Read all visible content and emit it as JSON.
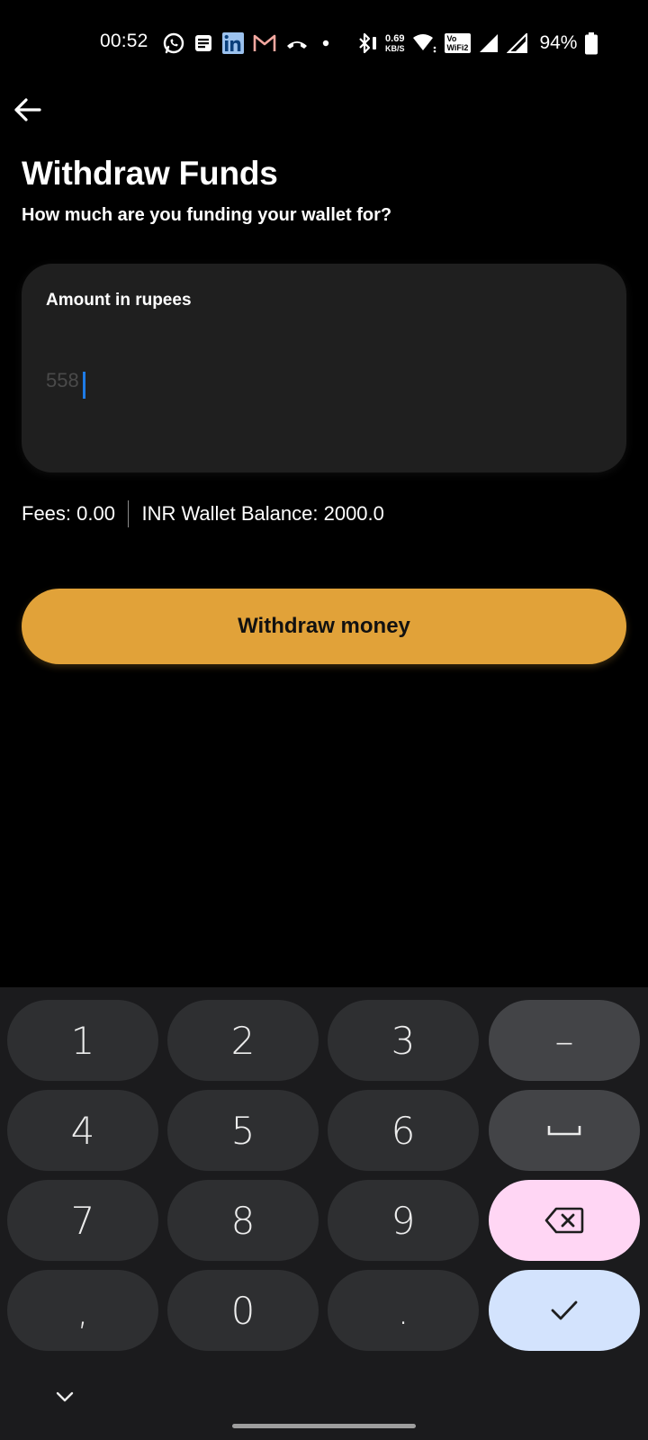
{
  "status_bar": {
    "time": "00:52",
    "left_icons": [
      "whatsapp-icon",
      "message-icon",
      "linkedin-icon",
      "gmail-icon",
      "missed-call-icon",
      "dot-icon"
    ],
    "net_speed_value": "0.69",
    "net_speed_unit": "KB/S",
    "vowifi_top": "Vo",
    "vowifi_bottom": "WiFi2",
    "battery": "94%"
  },
  "header": {
    "title": "Withdraw Funds",
    "subtitle": "How much are you funding your wallet for?"
  },
  "amount_card": {
    "label": "Amount in rupees",
    "value": "558"
  },
  "fees": {
    "fees_text": "Fees: 0.00",
    "balance_text": "INR Wallet Balance: 2000.0"
  },
  "withdraw_button": {
    "label": "Withdraw money"
  },
  "keyboard": {
    "rows": [
      [
        "1",
        "2",
        "3",
        "–"
      ],
      [
        "4",
        "5",
        "6",
        "␣"
      ],
      [
        "7",
        "8",
        "9",
        "⌫"
      ],
      [
        ",",
        "0",
        ".",
        "✓"
      ]
    ]
  },
  "colors": {
    "accent": "#e1a239",
    "background": "#000000",
    "card": "#1f1f1f",
    "caret": "#1e7be6",
    "backspace_key": "#ffd6f4",
    "enter_key": "#d3e3fd"
  }
}
